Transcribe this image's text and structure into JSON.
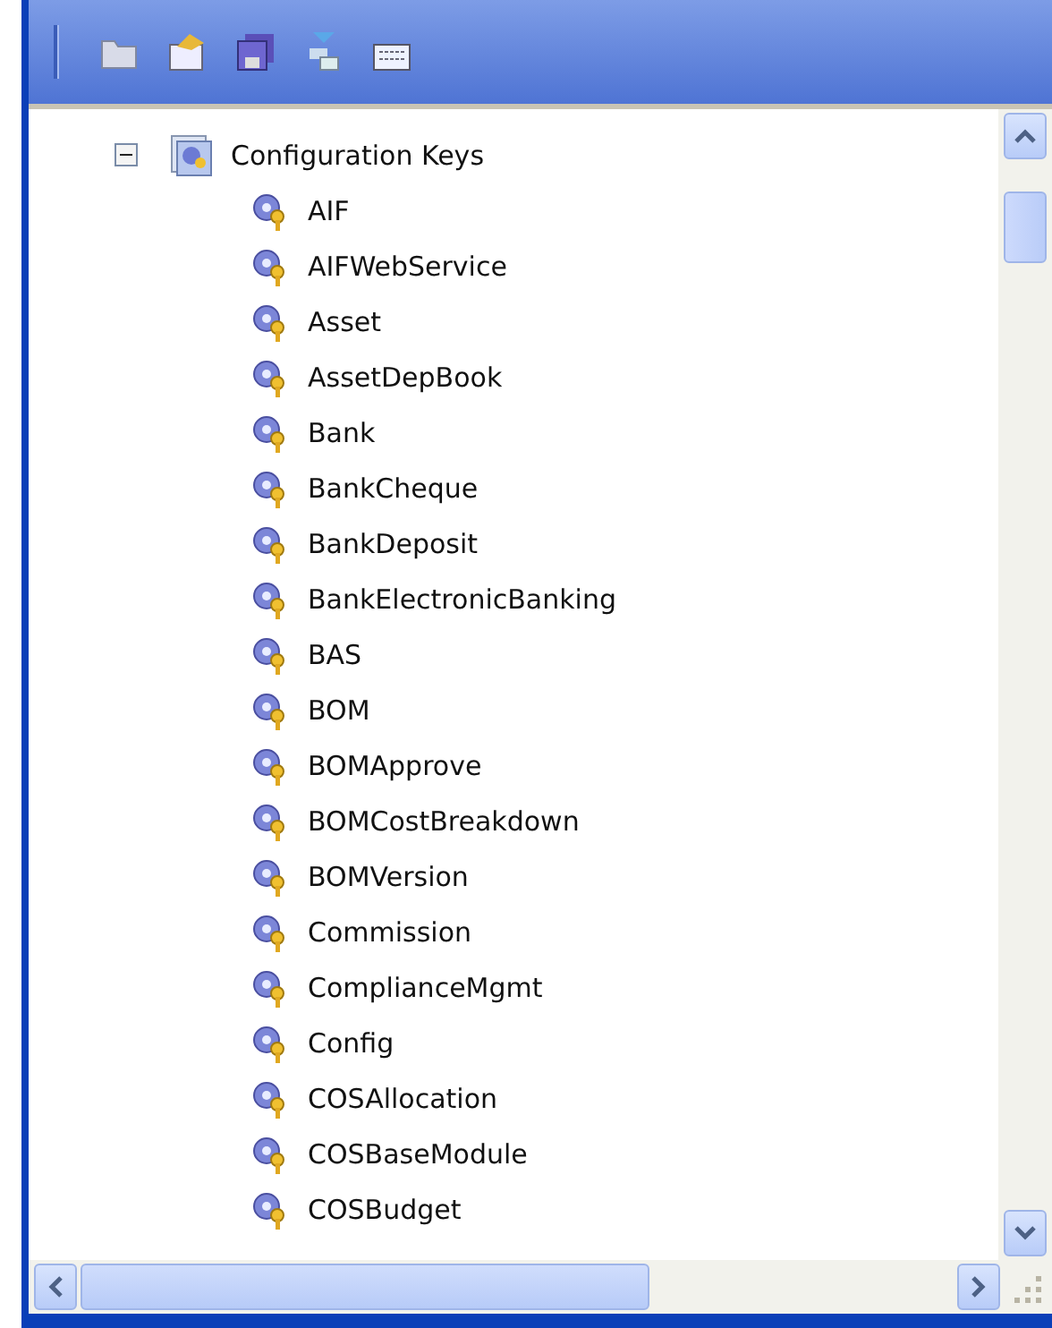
{
  "tree": {
    "label": "Configuration Keys",
    "expanded": true,
    "children": [
      {
        "label": "AIF"
      },
      {
        "label": "AIFWebService"
      },
      {
        "label": "Asset"
      },
      {
        "label": "AssetDepBook"
      },
      {
        "label": "Bank"
      },
      {
        "label": "BankCheque"
      },
      {
        "label": "BankDeposit"
      },
      {
        "label": "BankElectronicBanking"
      },
      {
        "label": "BAS"
      },
      {
        "label": "BOM"
      },
      {
        "label": "BOMApprove"
      },
      {
        "label": "BOMCostBreakdown"
      },
      {
        "label": "BOMVersion"
      },
      {
        "label": "Commission"
      },
      {
        "label": "ComplianceMgmt"
      },
      {
        "label": "Config"
      },
      {
        "label": "COSAllocation"
      },
      {
        "label": "COSBaseModule"
      },
      {
        "label": "COSBudget"
      }
    ]
  }
}
